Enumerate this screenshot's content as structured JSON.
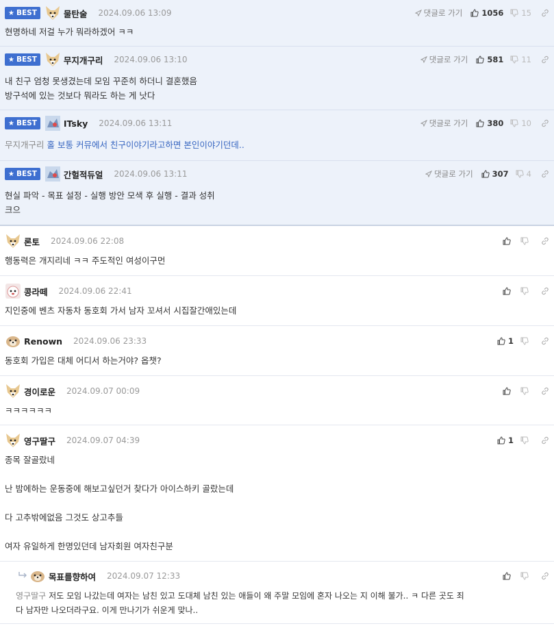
{
  "labels": {
    "best": "BEST",
    "goto": "댓글로 가기"
  },
  "best_comments": [
    {
      "nick": "물탄술",
      "date": "2024.09.06 13:09",
      "up": "1056",
      "down": "15",
      "lines": [
        "현명하네 저걸 누가 뭐라하겠어 ㅋㅋ"
      ]
    },
    {
      "nick": "무지개구리",
      "date": "2024.09.06 13:10",
      "up": "581",
      "down": "11",
      "lines": [
        "내 친구 엄청 못생겼는데 모임 꾸준히 하더니 결혼했음",
        "방구석에 있는 것보다 뭐라도 하는 게 낫다"
      ]
    },
    {
      "nick": "ITsky",
      "date": "2024.09.06 13:11",
      "up": "380",
      "down": "10",
      "mention": "무지개구리",
      "lines": [
        "홀 보통 커뮤에서 친구이야기라고하면 본인이야기던데.."
      ]
    },
    {
      "nick": "간헐적듀얼",
      "date": "2024.09.06 13:11",
      "up": "307",
      "down": "4",
      "lines": [
        "현실 파악 - 목표 설정 - 실행 방안 모색 후 실행 - 결과 성취",
        "크으"
      ]
    }
  ],
  "comments": [
    {
      "nick": "론토",
      "date": "2024.09.06 22:08",
      "up": "",
      "lines": [
        "행동력은 개지리네 ㅋㅋ 주도적인 여성이구먼"
      ]
    },
    {
      "nick": "콩라떼",
      "date": "2024.09.06 22:41",
      "up": "",
      "lines": [
        "지인중에 벤츠 자동차 동호회 가서 남자 꼬셔서 시집잘간애있는데"
      ]
    },
    {
      "nick": "Renown",
      "date": "2024.09.06 23:33",
      "up": "1",
      "lines": [
        "동호회 가입은 대체 어디서 하는거야? 옵챗?"
      ]
    },
    {
      "nick": "경이로운",
      "date": "2024.09.07 00:09",
      "up": "",
      "lines": [
        "ㅋㅋㅋㅋㅋㅋ"
      ]
    },
    {
      "nick": "영구딸구",
      "date": "2024.09.07 04:39",
      "up": "1",
      "lines": [
        "종목 잘골랐네",
        "",
        "난 밤에하는 운동중에 해보고싶던거 찾다가 아이스하키 골랐는데",
        "",
        "다 고추밖에없음 그것도 상고추들",
        "",
        "여자 유일하게 한명있던데 남자회원 여자친구분"
      ]
    }
  ],
  "reply": {
    "nick": "목표를향하여",
    "date": "2024.09.07 12:33",
    "up": "",
    "mention": "영구딸구",
    "lines": [
      "저도 모임 나갔는데 여자는 남친 있고 도대체 남친 있는 애들이 왜 주말 모임에 혼자 나오는 지 이해 불가.. ㅋ 다른 곳도 죄",
      "다 남자만 나오더라구요. 이게 만나기가 쉬운게 맞나.."
    ]
  },
  "colors": {
    "badge": "#3e6fd0",
    "best_bg": "#edf2fa",
    "mention_link": "#3665c0"
  },
  "icons": {
    "star": "star-icon",
    "goto": "send-arrow-icon",
    "up": "thumbs-up-icon",
    "down": "thumbs-down-icon",
    "link": "link-icon",
    "reply": "reply-arrow-icon"
  }
}
